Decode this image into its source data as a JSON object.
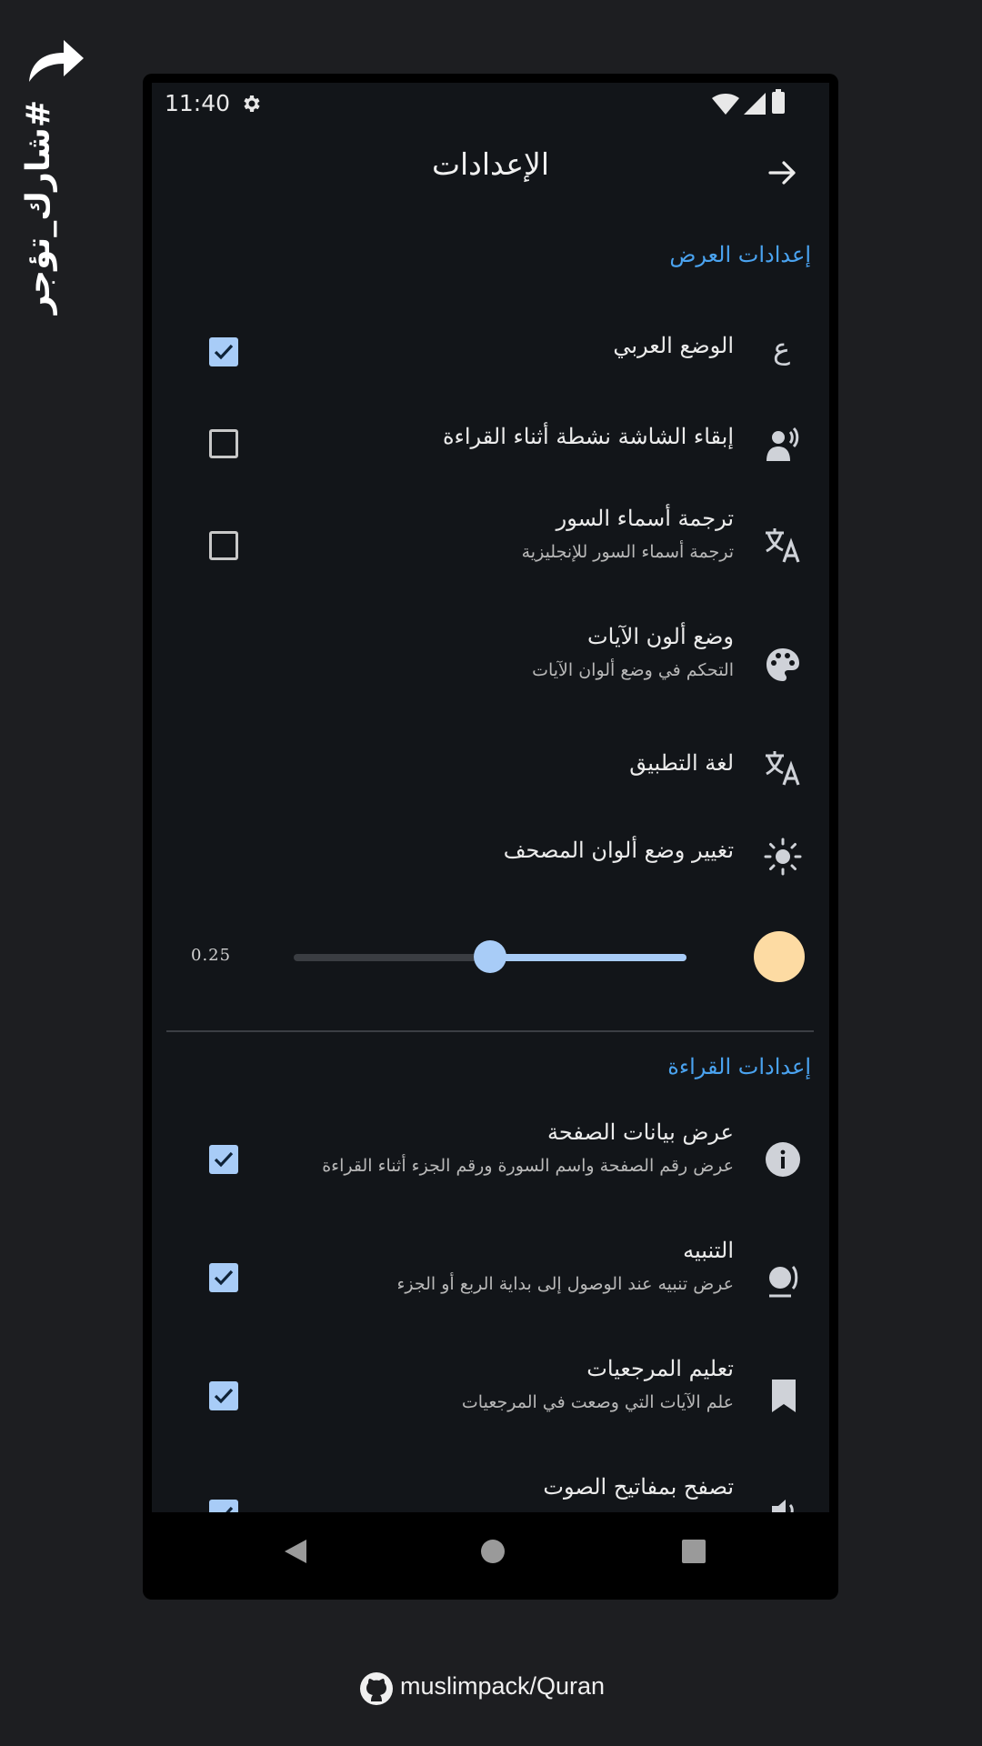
{
  "overlay": {
    "hashtag": "#شارك_تؤجر",
    "footer_repo": "muslimpack/Quran"
  },
  "status_bar": {
    "time": "11:40"
  },
  "app_bar": {
    "title": "الإعدادات"
  },
  "display_section": {
    "title": "إعدادات العرض",
    "items": [
      {
        "icon": "arabic-letter-icon",
        "glyph": "ع",
        "title": "الوضع العربي",
        "subtitle": "",
        "checked": true
      },
      {
        "icon": "screen-awake-icon",
        "title": "إبقاء الشاشة نشطة أثناء القراءة",
        "subtitle": "",
        "checked": false
      },
      {
        "icon": "translate-icon",
        "title": "ترجمة أسماء السور",
        "subtitle": "ترجمة أسماء السور للإنجليزية",
        "checked": false
      },
      {
        "icon": "palette-icon",
        "title": "وضع ألون الآيات",
        "subtitle": "التحكم في وضع ألوان الآيات"
      },
      {
        "icon": "translate-icon",
        "title": "لغة التطبيق",
        "subtitle": ""
      },
      {
        "icon": "brightness-icon",
        "title": "تغيير وضع ألوان المصحف",
        "subtitle": ""
      }
    ],
    "slider": {
      "value_label": "0.25",
      "value": 0.5,
      "swatch_color": "#fddba3"
    }
  },
  "reading_section": {
    "title": "إعدادات القراءة",
    "items": [
      {
        "icon": "info-icon",
        "title": "عرض بيانات الصفحة",
        "subtitle": "عرض رقم الصفحة واسم السورة ورقم الجزء أثناء القراءة",
        "checked": true
      },
      {
        "icon": "alert-bell-icon",
        "title": "التنبيه",
        "subtitle": "عرض تنبيه عند الوصول إلى بداية الربع أو الجزء",
        "checked": true
      },
      {
        "icon": "bookmark-icon",
        "title": "تعليم المرجعيات",
        "subtitle": "علم الآيات التي وصعت في المرجعيات",
        "checked": true
      },
      {
        "icon": "volume-icon",
        "title": "تصفح بمفاتيح الصوت",
        "subtitle": "",
        "checked": true
      }
    ]
  },
  "colors": {
    "accent": "#4aa3f0",
    "checkbox": "#a8ccf7",
    "background": "#121519"
  }
}
